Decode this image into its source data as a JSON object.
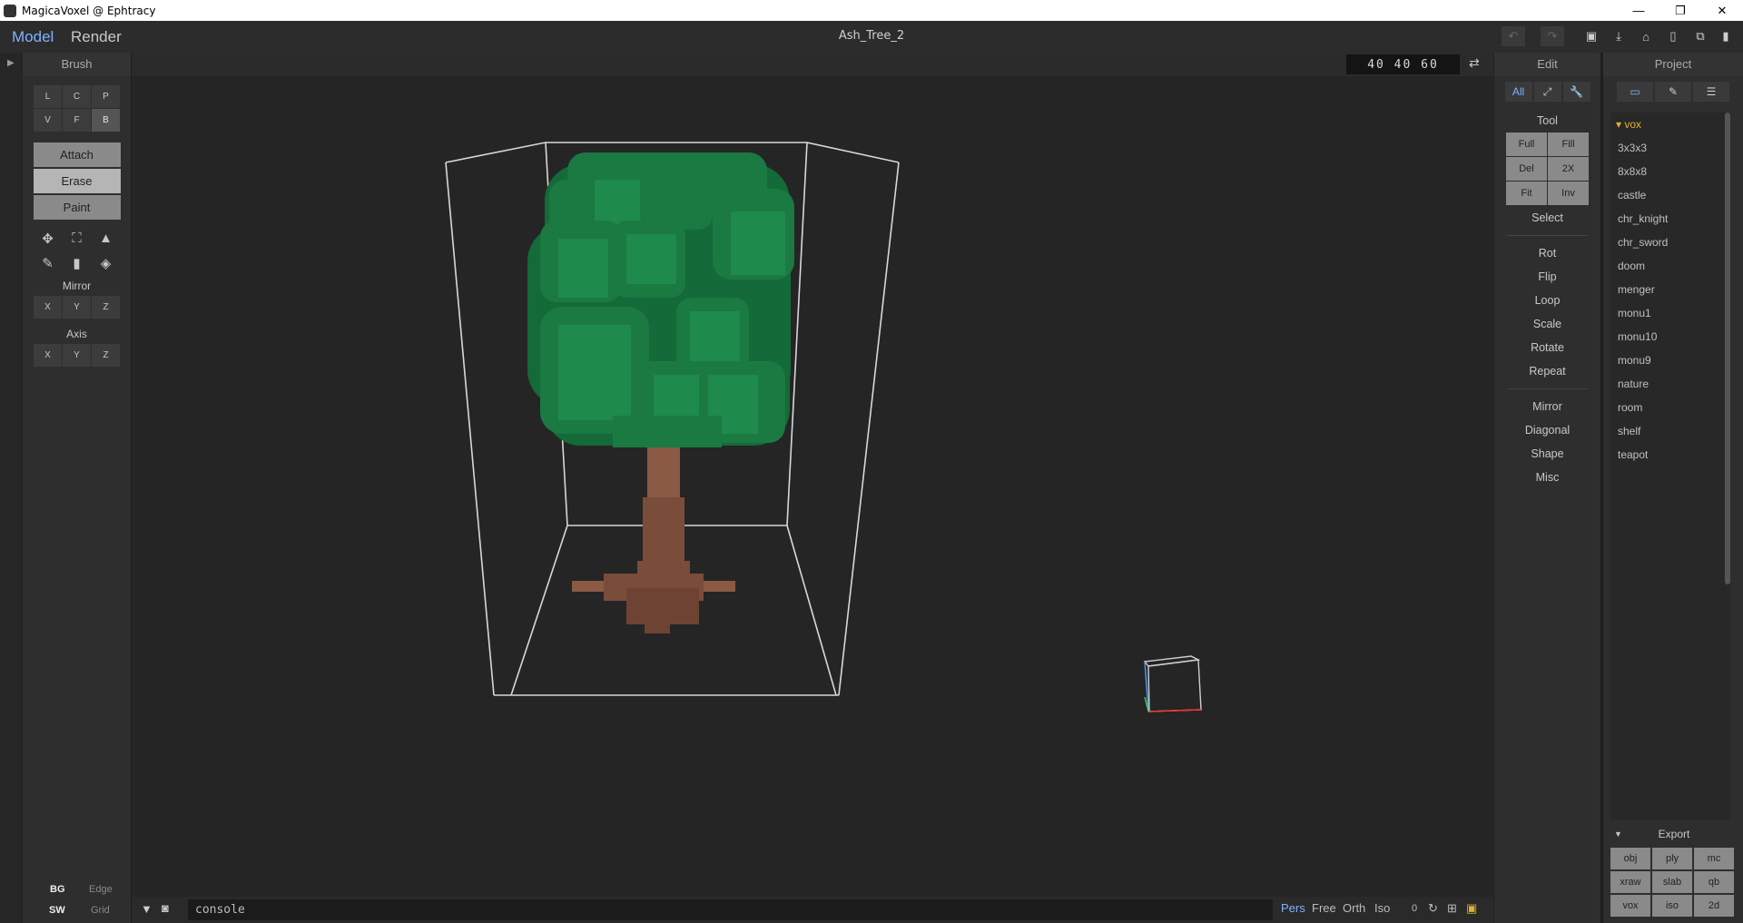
{
  "window": {
    "title": "MagicaVoxel @ Ephtracy",
    "controls": [
      "—",
      "❐",
      "✕"
    ]
  },
  "topbar": {
    "tabs": [
      {
        "label": "Model",
        "active": true
      },
      {
        "label": "Render",
        "active": false
      }
    ],
    "filename": "Ash_Tree_2",
    "toolbar_icons": [
      "undo-icon",
      "redo-icon",
      "save-icon",
      "save-as-icon",
      "open-icon",
      "new-icon",
      "copy-icon",
      "delete-icon"
    ]
  },
  "brush": {
    "title": "Brush",
    "types": [
      "L",
      "C",
      "P",
      "V",
      "F",
      "B"
    ],
    "selected_type": "B",
    "modes": [
      {
        "label": "Attach",
        "on": false
      },
      {
        "label": "Erase",
        "on": true
      },
      {
        "label": "Paint",
        "on": false
      }
    ],
    "tool_icons": [
      "move-icon",
      "select-icon",
      "pointer-icon",
      "eyedropper-icon",
      "trash-icon",
      "bucket-icon"
    ],
    "mirror_label": "Mirror",
    "mirror": [
      "X",
      "Y",
      "Z"
    ],
    "axis_label": "Axis",
    "axis": [
      "X",
      "Y",
      "Z"
    ]
  },
  "viewport": {
    "size": "40 40 60"
  },
  "bottombar": {
    "console": "console",
    "views": [
      {
        "label": "Pers",
        "active": true
      },
      {
        "label": "Free",
        "active": false
      },
      {
        "label": "Orth",
        "active": false
      },
      {
        "label": "Iso",
        "active": false
      }
    ],
    "zero": "0"
  },
  "bg_toggles": {
    "bg": "BG",
    "edge": "Edge",
    "sw": "SW",
    "grid": "Grid"
  },
  "edit": {
    "title": "Edit",
    "tabs": [
      "All",
      "⤢",
      "🔧"
    ],
    "tool_label": "Tool",
    "tools": [
      [
        "Full",
        "Fill"
      ],
      [
        "Del",
        "2X"
      ],
      [
        "Fit",
        "Inv"
      ]
    ],
    "select": "Select",
    "items1": [
      "Rot",
      "Flip",
      "Loop",
      "Scale",
      "Rotate",
      "Repeat"
    ],
    "items2": [
      "Mirror",
      "Diagonal",
      "Shape",
      "Misc"
    ]
  },
  "project": {
    "title": "Project",
    "folder": "vox",
    "files": [
      "3x3x3",
      "8x8x8",
      "castle",
      "chr_knight",
      "chr_sword",
      "doom",
      "menger",
      "monu1",
      "monu10",
      "monu9",
      "nature",
      "room",
      "shelf",
      "teapot"
    ],
    "export_label": "Export",
    "export": [
      "obj",
      "ply",
      "mc",
      "xraw",
      "slab",
      "qb",
      "vox",
      "iso",
      "2d"
    ]
  },
  "colors": {
    "accent": "#7fb3ff",
    "folder": "#e0b030",
    "leaf": "#1e8a4c",
    "leaf_dark": "#146a38",
    "trunk": "#8a5a44"
  }
}
